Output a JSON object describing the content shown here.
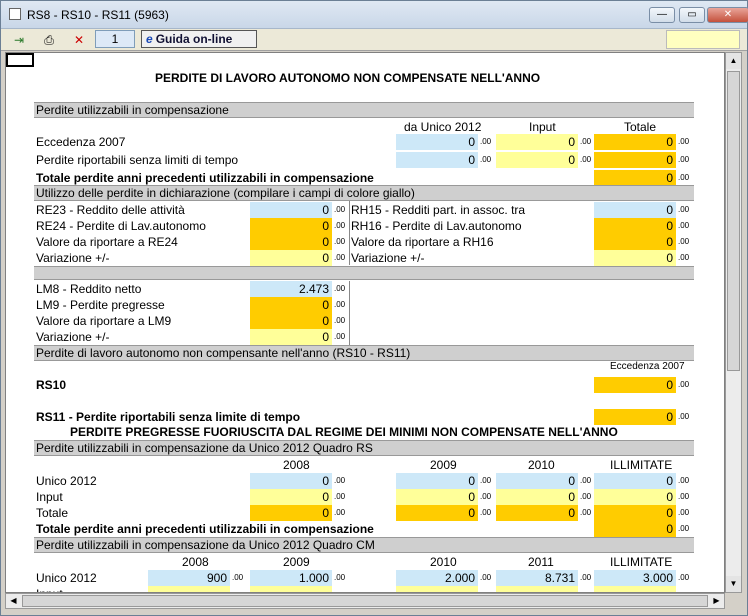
{
  "window": {
    "title": "RS8 - RS10 - RS11 (5963)"
  },
  "toolbar": {
    "page": "1",
    "guida": "Guida on-line"
  },
  "main": {
    "title": "PERDITE DI LAVORO AUTONOMO NON COMPENSATE NELL'ANNO",
    "sec1": "Perdite utilizzabili in compensazione",
    "col_unico": "da Unico 2012",
    "col_input": "Input",
    "col_totale": "Totale",
    "eccedenza": "Eccedenza 2007",
    "perdite_rip": "Perdite riportabili senza limiti di tempo",
    "totale_prec": "Totale perdite anni precedenti  utilizzabili in compensazione",
    "sec2": "Utilizzo delle perdite in dichiarazione (compilare i campi di colore giallo)",
    "re23": "RE23 - Reddito delle attività",
    "re24": "RE24 - Perdite di Lav.autonomo",
    "val_re24": "Valore da riportare a RE24",
    "variazione": "Variazione +/-",
    "rh15": "RH15 - Redditi  part. in assoc. tra",
    "rh16": "RH16 - Perdite di Lav.autonomo",
    "val_rh16": "Valore da riportare a RH16",
    "lm8": "LM8 - Reddito netto",
    "lm9": "LM9 - Perdite pregresse",
    "val_lm9": "Valore da riportare a LM9",
    "sec3": "Perdite di lavoro autonomo non compensante nell'anno (RS10 - RS11)",
    "ecc2007": "Eccedenza 2007",
    "rs10": "RS10",
    "rs11": "RS11 - Perdite riportabili senza limite di tempo",
    "title2": "PERDITE PREGRESSE FUORIUSCITA DAL REGIME DEI MINIMI NON COMPENSATE NELL'ANNO",
    "sec4": "Perdite utilizzabili in compensazione da Unico 2012 Quadro RS",
    "y2008": "2008",
    "y2009": "2009",
    "y2010": "2010",
    "y2011": "2011",
    "illimitate": "ILLIMITATE",
    "unico2012": "Unico 2012",
    "input": "Input",
    "totale": "Totale",
    "sec5": "Perdite utilizzabili in compensazione da Unico 2012 Quadro CM",
    "zero": "0",
    "dec": ".00",
    "lm8_val": "2.473",
    "cm_2008": "900",
    "cm_2009": "1.000",
    "cm_2010": "2.000",
    "cm_2011": "8.731",
    "cm_ill": "3.000"
  }
}
